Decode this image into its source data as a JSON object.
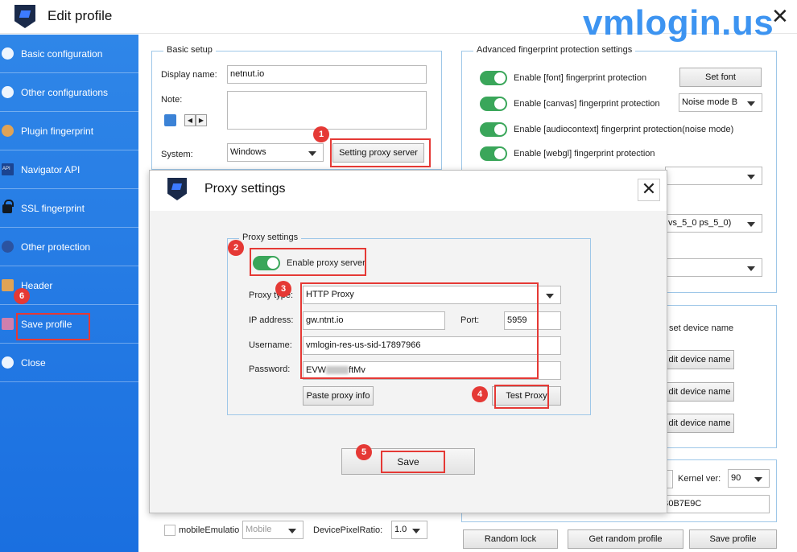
{
  "window": {
    "title": "Edit profile",
    "watermark": "vmlogin.us",
    "close_glyph": "✕"
  },
  "sidebar": {
    "items": [
      {
        "label": "Basic configuration",
        "icon": "compass-icon"
      },
      {
        "label": "Other configurations",
        "icon": "globe-icon"
      },
      {
        "label": "Plugin fingerprint",
        "icon": "plugin-icon"
      },
      {
        "label": "Navigator API",
        "icon": "api-icon"
      },
      {
        "label": "SSL fingerprint",
        "icon": "lock-icon"
      },
      {
        "label": "Other protection",
        "icon": "shield-icon"
      },
      {
        "label": "Header",
        "icon": "header-icon"
      },
      {
        "label": "Save profile",
        "icon": "save-icon"
      },
      {
        "label": "Close",
        "icon": "close-circle-icon"
      }
    ]
  },
  "basic_setup": {
    "legend": "Basic setup",
    "display_name_label": "Display name:",
    "display_name_value": "netnut.io",
    "note_label": "Note:",
    "system_label": "System:",
    "system_value": "Windows",
    "proxy_button": "Setting proxy server"
  },
  "advanced": {
    "legend": "Advanced fingerprint protection settings",
    "rows": [
      {
        "label": "Enable [font] fingerprint protection"
      },
      {
        "label": "Enable [canvas] fingerprint protection"
      },
      {
        "label": "Enable [audiocontext] fingerprint  protection(noise mode)"
      },
      {
        "label": "Enable [webgl] fingerprint protection"
      }
    ],
    "set_font_button": "Set font",
    "canvas_mode": "Noise mode B",
    "shader_value": "vs_5_0 ps_5_0)"
  },
  "device": {
    "set_device_name_label": "set device name",
    "edit_buttons": [
      "dit device name",
      "dit device name",
      "dit device name"
    ]
  },
  "kernel": {
    "label": "Kernel ver:",
    "value": "90",
    "hash": "B0B7E9C"
  },
  "bottom": {
    "mobile_label": "mobileEmulatio",
    "mobile_select": "Mobile",
    "dpr_label": "DevicePixelRatio:",
    "dpr_value": "1.0",
    "random_lock": "Random lock",
    "get_random_profile": "Get random profile",
    "save_profile": "Save profile"
  },
  "proxy_dialog": {
    "title": "Proxy settings",
    "legend": "Proxy settings",
    "enable_label": "Enable proxy server",
    "proxy_type_label": "Proxy type:",
    "proxy_type_value": "HTTP Proxy",
    "ip_label": "IP address:",
    "ip_value": "gw.ntnt.io",
    "port_label": "Port:",
    "port_value": "5959",
    "username_label": "Username:",
    "username_value": "vmlogin-res-us-sid-17897966",
    "password_label": "Password:",
    "password_value": "EVW",
    "password_suffix": "ftMv",
    "paste_button": "Paste proxy info",
    "test_button": "Test Proxy",
    "save_button": "Save"
  },
  "markers": [
    "1",
    "2",
    "3",
    "4",
    "5",
    "6"
  ],
  "colors": {
    "sidebar": "#1a6fe0",
    "accent_red": "#e53935",
    "toggle_green": "#3aa65a",
    "watermark": "#2d8cf0"
  }
}
